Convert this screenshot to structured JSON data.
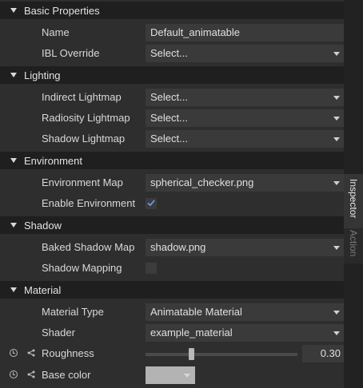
{
  "sections": {
    "basic": "Basic Properties",
    "lighting": "Lighting",
    "environment": "Environment",
    "shadow": "Shadow",
    "material": "Material"
  },
  "basic": {
    "name_label": "Name",
    "name_value": "Default_animatable",
    "ibl_label": "IBL Override",
    "ibl_value": "Select..."
  },
  "lighting": {
    "indirect_label": "Indirect Lightmap",
    "indirect_value": "Select...",
    "radiosity_label": "Radiosity Lightmap",
    "radiosity_value": "Select...",
    "shadow_label": "Shadow Lightmap",
    "shadow_value": "Select..."
  },
  "environment": {
    "map_label": "Environment Map",
    "map_value": "spherical_checker.png",
    "enable_label": "Enable Environment",
    "enable_checked": true
  },
  "shadow": {
    "baked_label": "Baked Shadow Map",
    "baked_value": "shadow.png",
    "mapping_label": "Shadow Mapping",
    "mapping_checked": false
  },
  "material": {
    "type_label": "Material Type",
    "type_value": "Animatable Material",
    "shader_label": "Shader",
    "shader_value": "example_material",
    "roughness_label": "Roughness",
    "roughness_value": "0.30",
    "roughness_level": 0.3,
    "base_color_label": "Base color",
    "base_color": "#b3b3b3"
  },
  "sidebar": {
    "inspector": "Inspector",
    "action": "Action"
  },
  "icons": [
    "chevron-down-icon",
    "checkmark-icon",
    "clock-icon",
    "share-icon"
  ]
}
